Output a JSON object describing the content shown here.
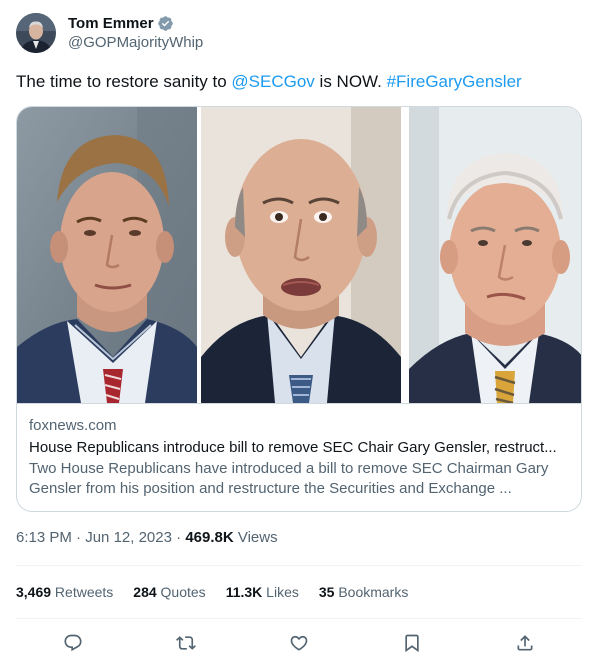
{
  "author": {
    "display_name": "Tom Emmer",
    "handle": "@GOPMajorityWhip",
    "verified": true,
    "avatar": "avatar-photo"
  },
  "tweet": {
    "text_before": "The time to restore sanity to ",
    "mention": "@SECGov",
    "text_middle": " is NOW. ",
    "hashtag": "#FireGaryGensler"
  },
  "link_card": {
    "domain": "foxnews.com",
    "title": "House Republicans introduce bill to remove SEC Chair Gary Gensler, restruct...",
    "description": "Two House Republicans have introduced a bill to remove SEC Chairman Gary Gensler from his position and restructure the Securities and Exchange ...",
    "image": "three-portrait-photos"
  },
  "meta": {
    "time": "6:13 PM",
    "separator": " · ",
    "date": "Jun 12, 2023",
    "views_count": "469.8K",
    "views_label": " Views"
  },
  "stats": {
    "retweets_count": "3,469",
    "retweets_label": " Retweets",
    "quotes_count": "284",
    "quotes_label": " Quotes",
    "likes_count": "11.3K",
    "likes_label": " Likes",
    "bookmarks_count": "35",
    "bookmarks_label": " Bookmarks"
  },
  "actions": [
    "reply-icon",
    "retweet-icon",
    "like-icon",
    "bookmark-icon",
    "share-icon"
  ],
  "colors": {
    "link": "#1d9bf0",
    "text": "#0f1419",
    "secondary": "#536471",
    "border": "#cfd9de",
    "divider": "#eff3f4"
  }
}
